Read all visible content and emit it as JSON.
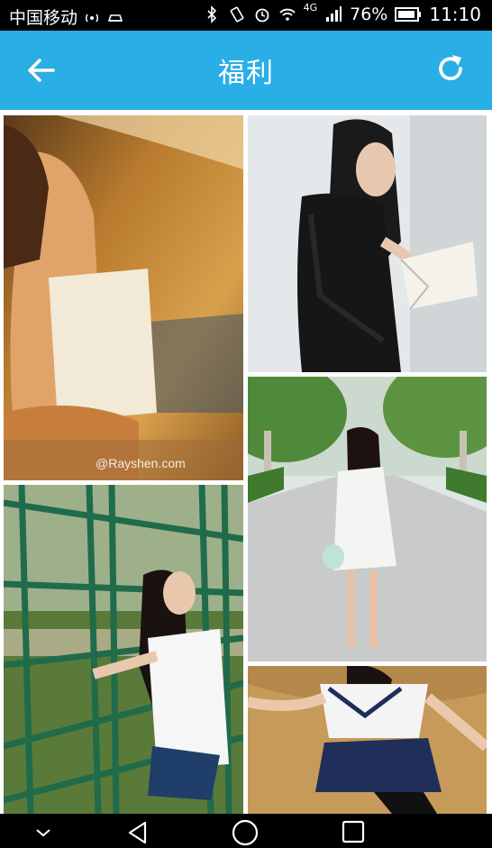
{
  "status_bar": {
    "carrier": "中国移动",
    "network": "4G",
    "battery": "76%",
    "time": "11:10"
  },
  "app_bar": {
    "title": "福利",
    "back_icon": "arrow-left-icon",
    "refresh_icon": "refresh-icon"
  },
  "grid": {
    "watermark": "@Rayshen.com",
    "photos": [
      {
        "name": "photo-girl-warm-room"
      },
      {
        "name": "photo-girl-reading-book"
      },
      {
        "name": "photo-girl-park-path"
      },
      {
        "name": "photo-girl-green-fence"
      },
      {
        "name": "photo-girl-sailor-uniform"
      }
    ]
  },
  "nav_bar": {
    "buttons": [
      "collapse-icon",
      "back-triangle-icon",
      "home-circle-icon",
      "recents-square-icon"
    ]
  },
  "colors": {
    "accent": "#29aee6",
    "status_bar": "#000000"
  }
}
